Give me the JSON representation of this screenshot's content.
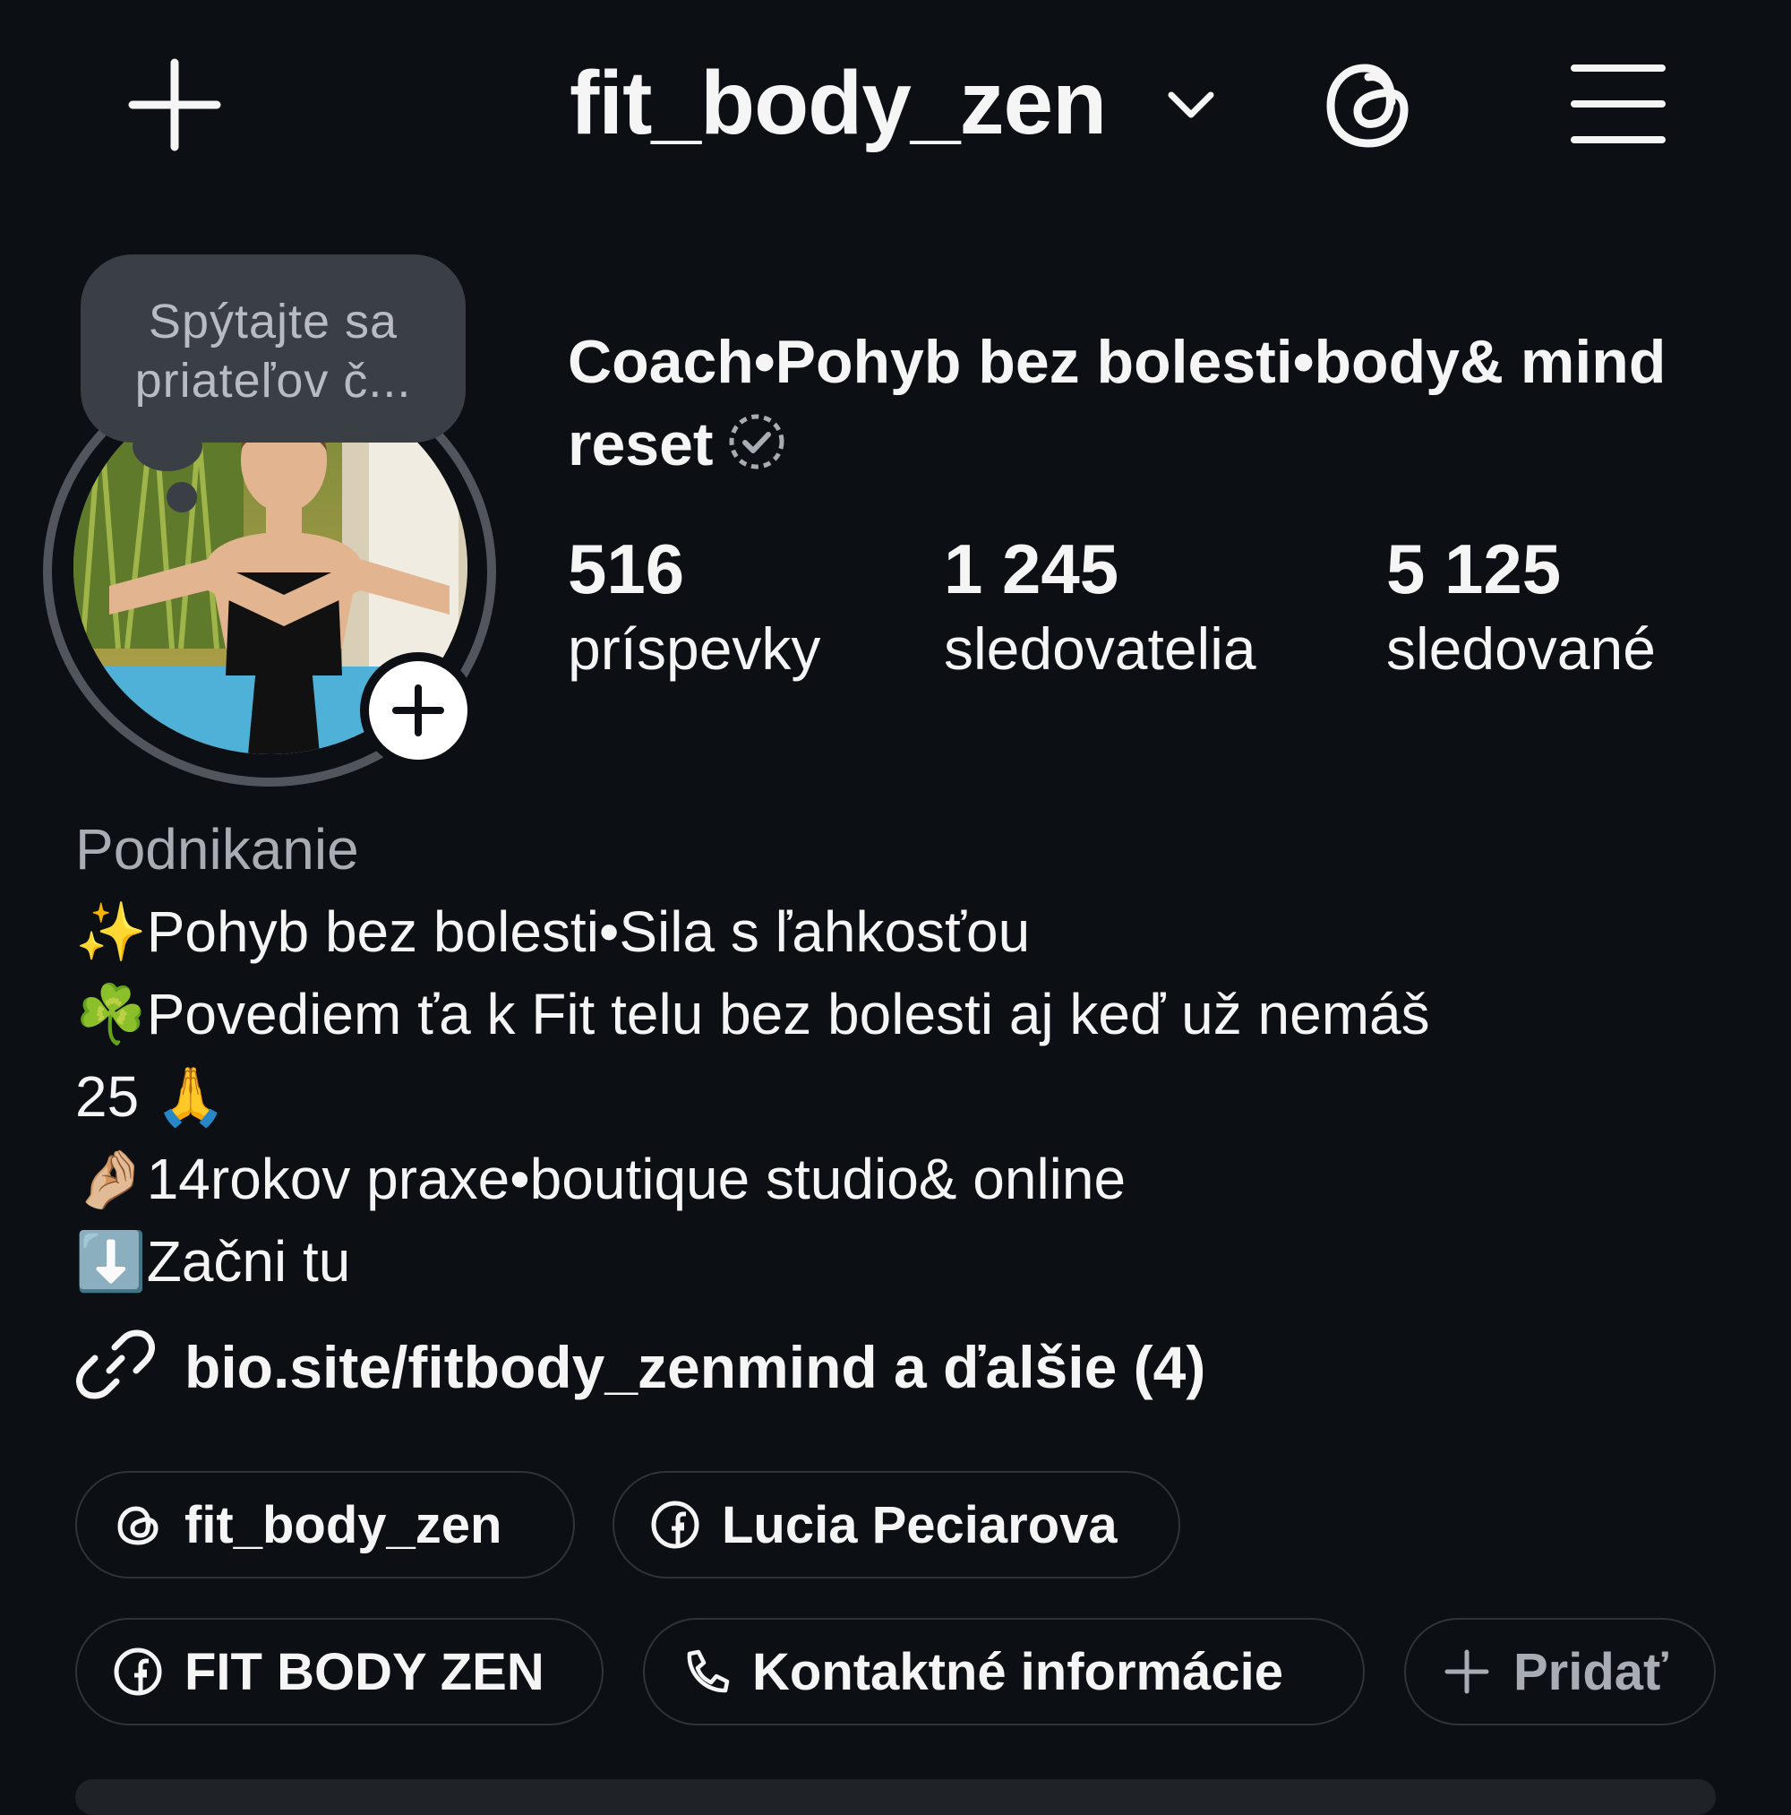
{
  "header": {
    "username": "fit_body_zen",
    "icons": [
      "plus-icon",
      "chevron-down-icon",
      "threads-icon",
      "hamburger-menu-icon"
    ]
  },
  "note": {
    "text": "Spýtajte sa priateľov č..."
  },
  "profile": {
    "display_name": "Coach•Pohyb bez bolesti•body& mind reset",
    "verified_icon": "verified-badge-outline-icon",
    "stats": [
      {
        "value": "516",
        "label": "príspevky"
      },
      {
        "value": "1 245",
        "label": "sledovatelia"
      },
      {
        "value": "5 125",
        "label": "sledované"
      }
    ]
  },
  "bio": {
    "category": "Podnikanie",
    "lines": [
      "✨Pohyb bez bolesti•Sila s ľahkosťou",
      "☘️Povediem ťa k Fit telu bez bolesti aj keď už nemáš",
      "25 🙏",
      "🤌🏼14rokov praxe•boutique studio& online",
      "⬇️Začni tu"
    ],
    "link": "bio.site/fitbody_zenmind a ďalšie (4)"
  },
  "chips": [
    {
      "label": "fit_body_zen",
      "icon": "threads-icon"
    },
    {
      "label": "Lucia Peciarova",
      "icon": "facebook-icon"
    },
    {
      "label": "FIT BODY ZEN",
      "icon": "facebook-icon"
    },
    {
      "label": "Kontaktné informácie",
      "icon": "phone-icon"
    },
    {
      "label": "Pridať",
      "icon": "plus-icon"
    }
  ],
  "colors": {
    "background": "#0c1014",
    "text": "#f5f5f5",
    "muted": "#a8adb3",
    "chip_border": "#2f3439",
    "note_bubble": "#3a3f46"
  }
}
